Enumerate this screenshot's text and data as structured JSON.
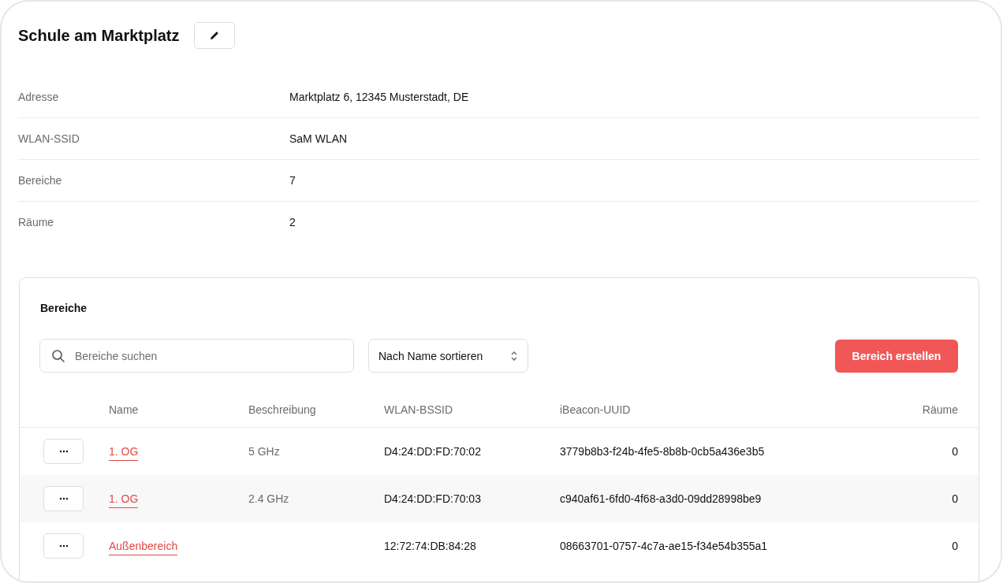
{
  "title": "Schule am Marktplatz",
  "details": [
    {
      "label": "Adresse",
      "value": "Marktplatz 6, 12345 Musterstadt, DE"
    },
    {
      "label": "WLAN-SSID",
      "value": "SaM WLAN"
    },
    {
      "label": "Bereiche",
      "value": "7"
    },
    {
      "label": "Räume",
      "value": "2"
    }
  ],
  "areas": {
    "title": "Bereiche",
    "search": {
      "placeholder": "Bereiche suchen"
    },
    "sort": {
      "value": "Nach Name sortieren"
    },
    "create_button": "Bereich erstellen",
    "columns": [
      "Name",
      "Beschreibung",
      "WLAN-BSSID",
      "iBeacon-UUID",
      "Räume"
    ],
    "rows": [
      {
        "name": "1. OG",
        "description": "5 GHz",
        "bssid": "D4:24:DD:FD:70:02",
        "uuid": "3779b8b3-f24b-4fe5-8b8b-0cb5a436e3b5",
        "rooms": "0"
      },
      {
        "name": "1. OG",
        "description": "2.4 GHz",
        "bssid": "D4:24:DD:FD:70:03",
        "uuid": "c940af61-6fd0-4f68-a3d0-09dd28998be9",
        "rooms": "0"
      },
      {
        "name": "Außenbereich",
        "bssid": "12:72:74:DB:84:28",
        "uuid": "08663701-0757-4c7a-ae15-f34e54b355a1",
        "rooms": "0"
      }
    ]
  }
}
